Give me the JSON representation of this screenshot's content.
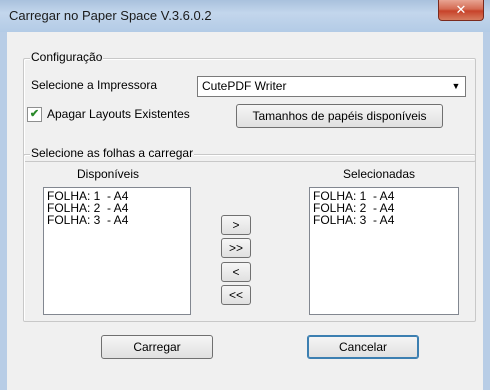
{
  "window": {
    "title": "Carregar no Paper Space V.3.6.0.2"
  },
  "config": {
    "group_label": "Configuração",
    "printer_label": "Selecione a Impressora",
    "printer_value": "CutePDF Writer",
    "delete_layouts_label": "Apagar Layouts Existentes",
    "delete_layouts_checked": true,
    "paper_sizes_button": "Tamanhos de papéis disponíveis"
  },
  "sheets": {
    "group_label": "Selecione as folhas a carregar",
    "available_header": "Disponíveis",
    "selected_header": "Selecionadas",
    "available": [
      "FOLHA: 1  - A4",
      "FOLHA: 2  - A4",
      "FOLHA: 3  - A4"
    ],
    "selected": [
      "FOLHA: 1  - A4",
      "FOLHA: 2  - A4",
      "FOLHA: 3  - A4"
    ],
    "move_one_right": ">",
    "move_all_right": ">>",
    "move_one_left": "<",
    "move_all_left": "<<"
  },
  "footer": {
    "load_button": "Carregar",
    "cancel_button": "Cancelar"
  }
}
